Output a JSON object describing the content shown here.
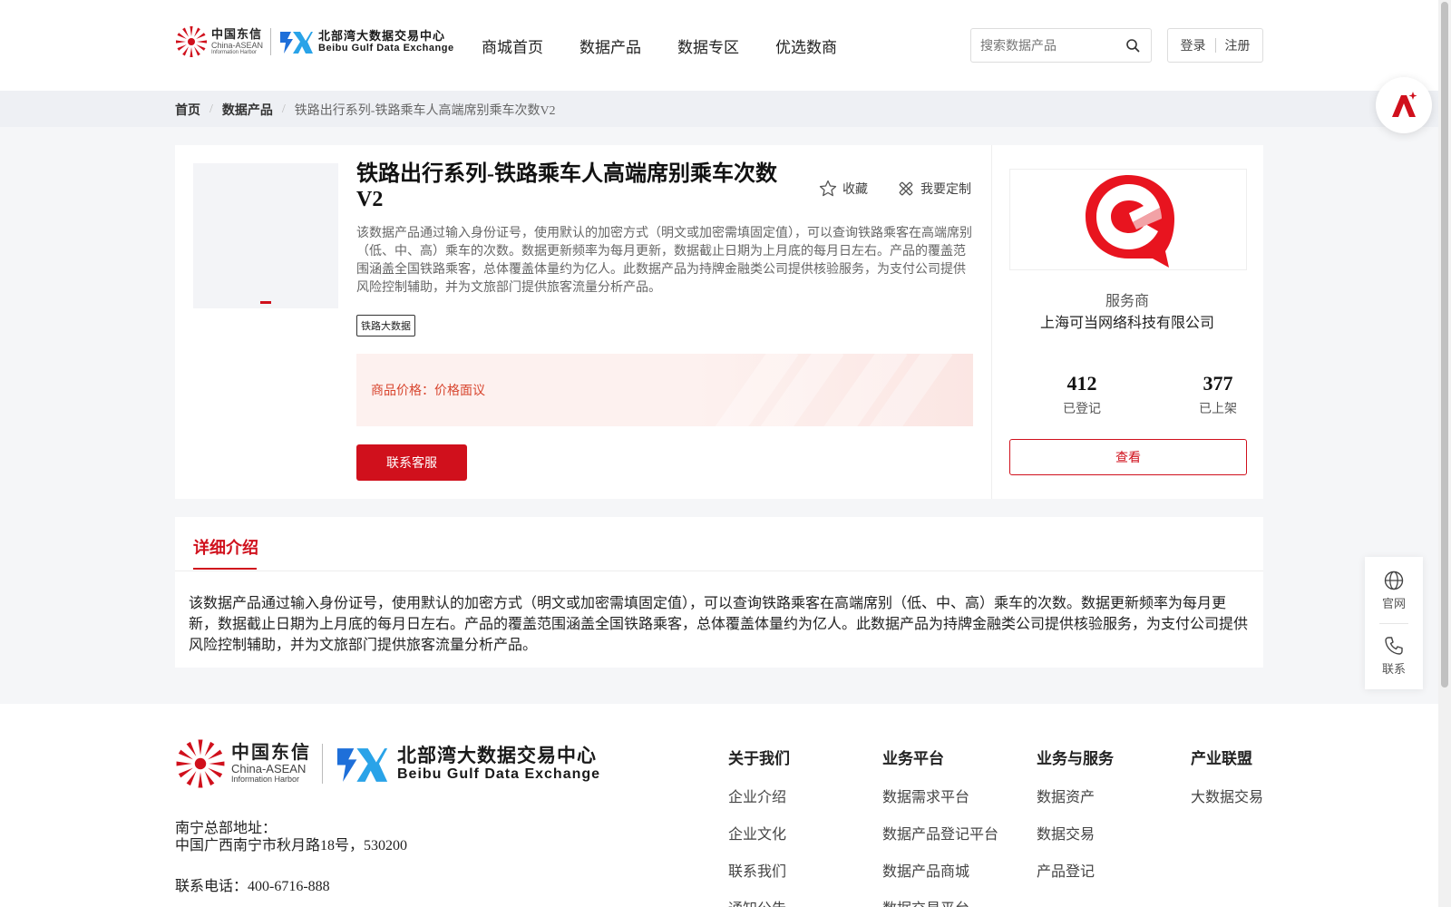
{
  "header": {
    "logo_cn": "中国东信",
    "logo_cn_en1": "China-ASEAN",
    "logo_cn_en2": "Information Harbor",
    "logo_bg_cn": "北部湾大数据交易中心",
    "logo_bg_en": "Beibu Gulf Data Exchange",
    "nav": [
      "商城首页",
      "数据产品",
      "数据专区",
      "优选数商"
    ],
    "search_placeholder": "搜索数据产品",
    "login": "登录",
    "register": "注册"
  },
  "breadcrumb": {
    "home": "首页",
    "section": "数据产品",
    "current": "铁路出行系列-铁路乘车人高端席别乘车次数V2"
  },
  "product": {
    "title": "铁路出行系列-铁路乘车人高端席别乘车次数V2",
    "favorite": "收藏",
    "customize": "我要定制",
    "description": "该数据产品通过输入身份证号，使用默认的加密方式（明文或加密需填固定值），可以查询铁路乘客在高端席别（低、中、高）乘车的次数。数据更新频率为每月更新，数据截止日期为上月底的每月日左右。产品的覆盖范围涵盖全国铁路乘客，总体覆盖体量约为亿人。此数据产品为持牌金融类公司提供核验服务，为支付公司提供风险控制辅助，并为文旅部门提供旅客流量分析产品。",
    "tag": "铁路大数据",
    "price_label": "商品价格：价格面议",
    "contact_button": "联系客服"
  },
  "vendor": {
    "role": "服务商",
    "name": "上海可当网络科技有限公司",
    "registered_count": "412",
    "registered_label": "已登记",
    "listed_count": "377",
    "listed_label": "已上架",
    "view_button": "查看"
  },
  "detail": {
    "tab": "详细介绍",
    "body": "该数据产品通过输入身份证号，使用默认的加密方式（明文或加密需填固定值），可以查询铁路乘客在高端席别（低、中、高）乘车的次数。数据更新频率为每月更新，数据截止日期为上月底的每月日左右。产品的覆盖范围涵盖全国铁路乘客，总体覆盖体量约为亿人。此数据产品为持牌金融类公司提供核验服务，为支付公司提供风险控制辅助，并为文旅部门提供旅客流量分析产品。"
  },
  "side": {
    "website": "官网",
    "contact": "联系"
  },
  "footer": {
    "address_label": "南宁总部地址：",
    "address": "中国广西南宁市秋月路18号，530200",
    "phone": "联系电话：400-6716-888",
    "columns": [
      {
        "title": "关于我们",
        "items": [
          "企业介绍",
          "企业文化",
          "联系我们",
          "通知公告"
        ]
      },
      {
        "title": "业务平台",
        "items": [
          "数据需求平台",
          "数据产品登记平台",
          "数据产品商城",
          "数据交易平台"
        ]
      },
      {
        "title": "业务与服务",
        "items": [
          "数据资产",
          "数据交易",
          "产品登记"
        ]
      },
      {
        "title": "产业联盟",
        "items": [
          "大数据交易"
        ]
      }
    ]
  },
  "colors": {
    "brand_red": "#d0101c",
    "price_orange": "#d8452e"
  }
}
